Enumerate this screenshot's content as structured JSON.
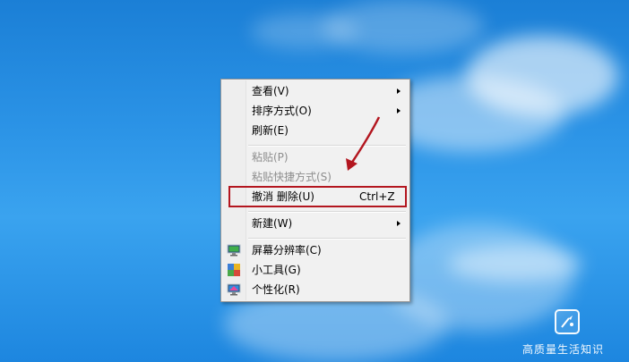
{
  "menu": {
    "items": [
      {
        "label": "查看(V)"
      },
      {
        "label": "排序方式(O)"
      },
      {
        "label": "刷新(E)"
      },
      {
        "label": "粘贴(P)"
      },
      {
        "label": "粘贴快捷方式(S)"
      },
      {
        "label": "撤消 删除(U)",
        "shortcut": "Ctrl+Z"
      },
      {
        "label": "新建(W)"
      },
      {
        "label": "屏幕分辨率(C)",
        "icon": "monitor-icon"
      },
      {
        "label": "小工具(G)",
        "icon": "gadgets-icon"
      },
      {
        "label": "个性化(R)",
        "icon": "personalize-icon"
      }
    ]
  },
  "watermark": {
    "text": "高质量生活知识"
  },
  "colors": {
    "desktop_blue": "#2b93e6",
    "highlight_red": "#b3161f"
  }
}
